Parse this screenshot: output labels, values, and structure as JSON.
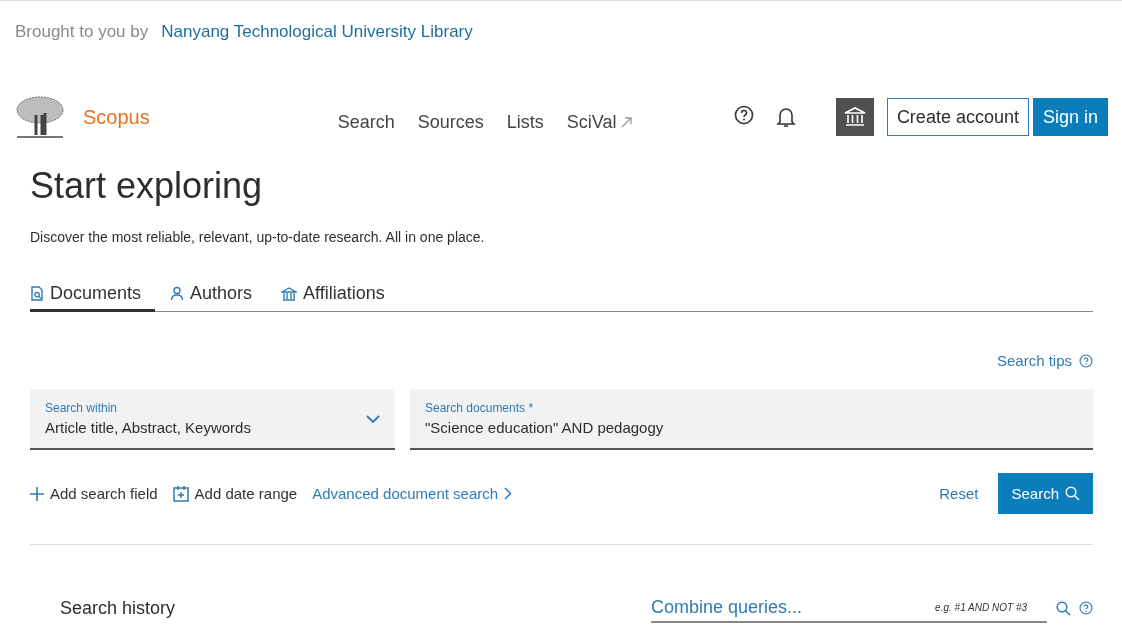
{
  "provider": {
    "prefix": "Brought to you by",
    "institution": "Nanyang Technological University Library"
  },
  "header": {
    "brand": "Scopus",
    "nav": [
      {
        "label": "Search",
        "external": false
      },
      {
        "label": "Sources",
        "external": false
      },
      {
        "label": "Lists",
        "external": false
      },
      {
        "label": "SciVal",
        "external": true
      }
    ],
    "create_account": "Create account",
    "sign_in": "Sign in"
  },
  "title": "Start exploring",
  "subtitle": "Discover the most reliable, relevant, up-to-date research. All in one place.",
  "tabs": [
    {
      "label": "Documents",
      "kind": "documents",
      "selected": true
    },
    {
      "label": "Authors",
      "kind": "authors",
      "selected": false
    },
    {
      "label": "Affiliations",
      "kind": "affiliations",
      "selected": false
    }
  ],
  "search_tips": "Search tips",
  "search_within": {
    "label": "Search within",
    "value": "Article title, Abstract, Keywords"
  },
  "search_documents": {
    "label": "Search documents",
    "required_mark": "*",
    "value": "\"Science education\" AND pedagogy"
  },
  "actions": [
    {
      "label": "Add search field",
      "kind": "add"
    },
    {
      "label": "Add date range",
      "kind": "date"
    },
    {
      "label": "Advanced document search",
      "kind": "advanced"
    }
  ],
  "reset": "Reset",
  "search_button": "Search",
  "history": {
    "title": "Search history",
    "placeholder": "Combine queries...",
    "hint": "e.g. #1 AND NOT #3"
  }
}
